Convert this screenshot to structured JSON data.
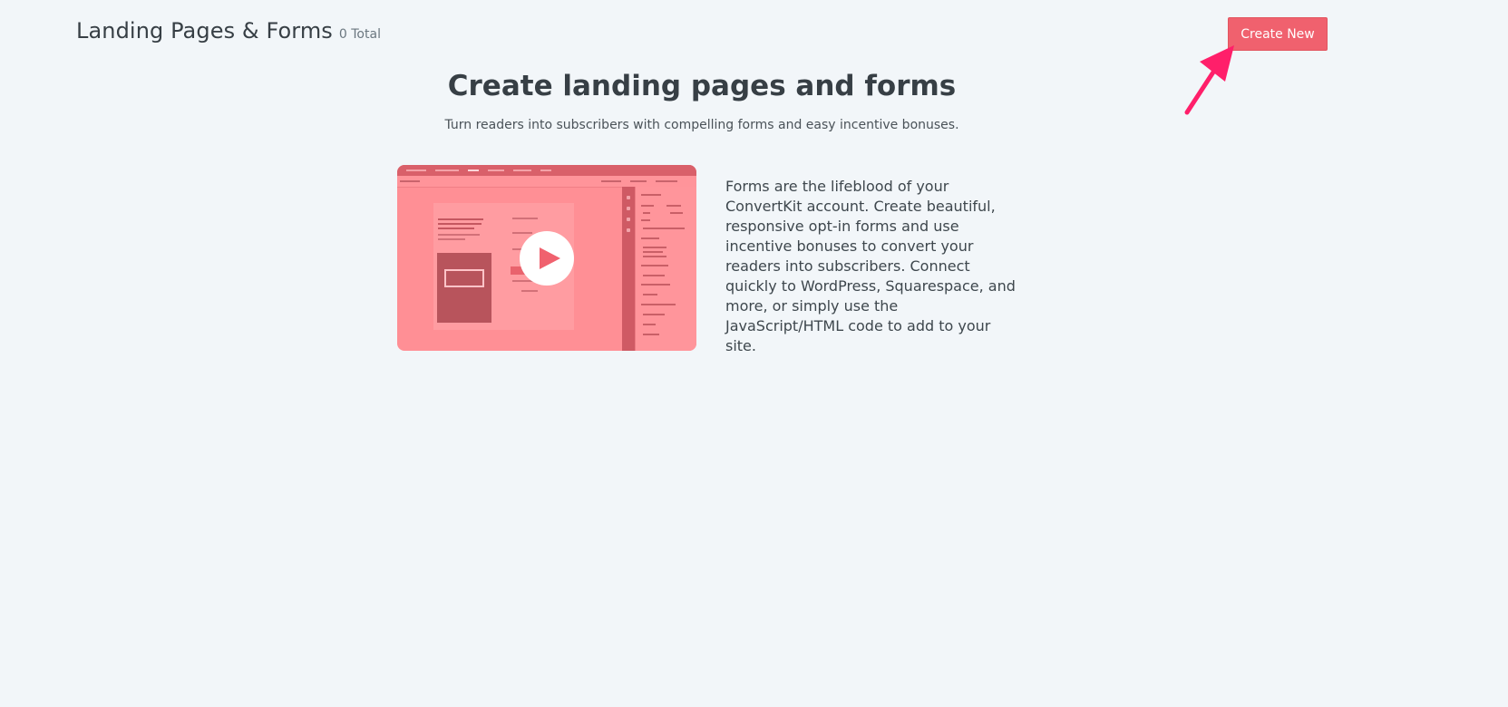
{
  "header": {
    "title": "Landing Pages & Forms",
    "count": "0 Total"
  },
  "toolbar": {
    "create_label": "Create New"
  },
  "hero": {
    "title": "Create landing pages and forms",
    "subtitle": "Turn readers into subscribers with compelling forms and easy incentive bonuses."
  },
  "video": {
    "play_icon": "play-icon"
  },
  "description": "Forms are the lifeblood of your ConvertKit account. Create beautiful, responsive opt-in forms and use incentive bonuses to convert your readers into subscribers. Connect quickly to WordPress, Squarespace, and more, or simply use the JavaScript/HTML code to add to your site.",
  "colors": {
    "background": "#f2f6f9",
    "accent": "#f0616e",
    "arrow": "#ff1f6a",
    "video_overlay": "#ff8f95"
  }
}
